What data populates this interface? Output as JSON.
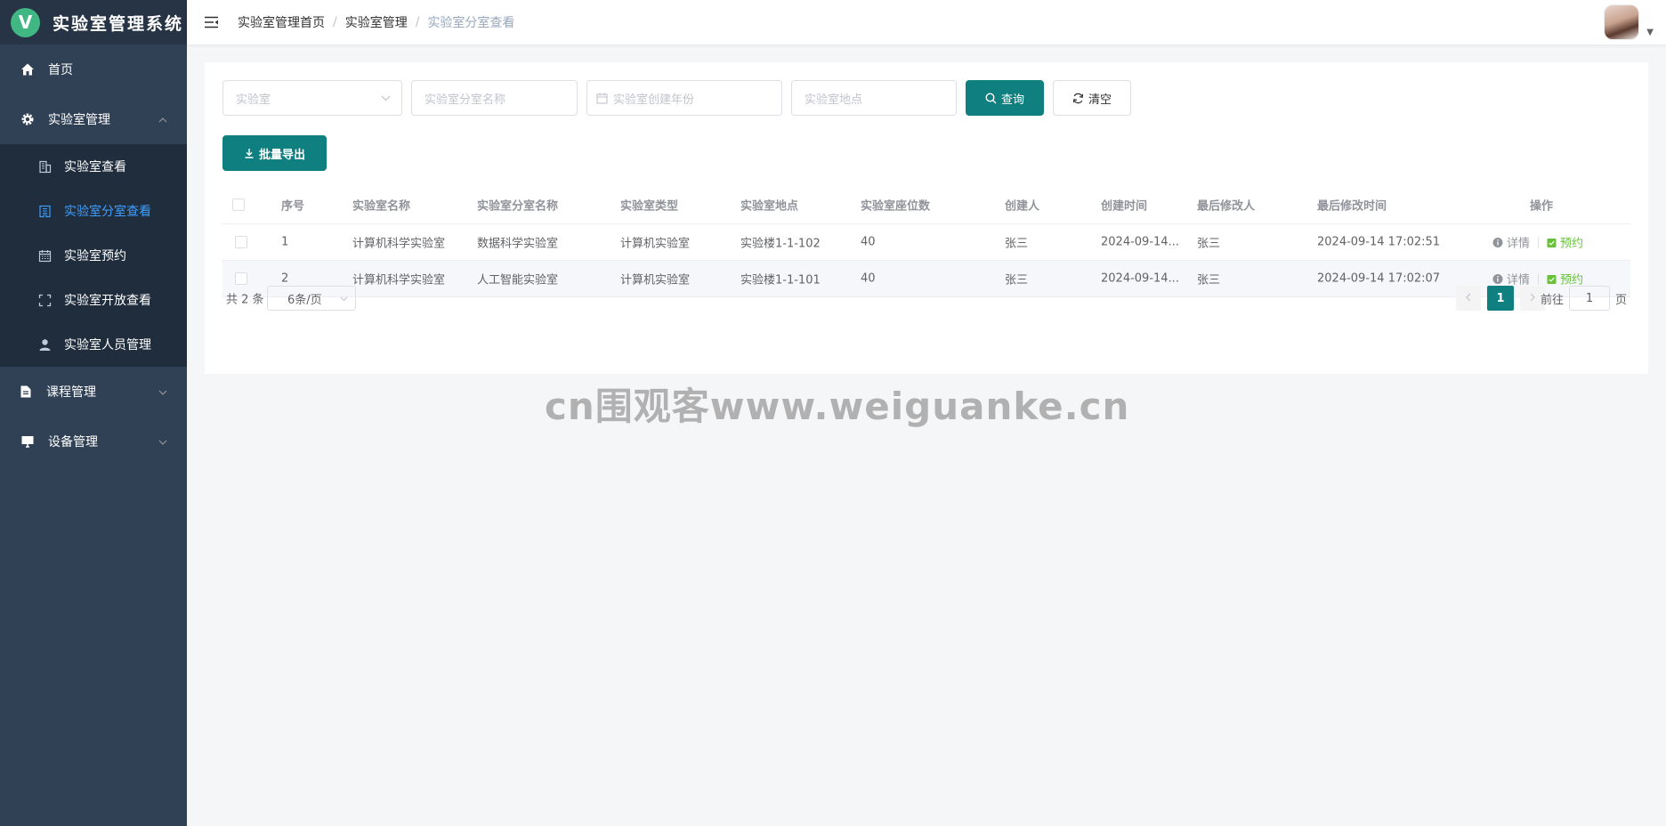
{
  "app": {
    "logo_letter": "V",
    "title": "实验室管理系统"
  },
  "sidebar": {
    "items": [
      {
        "label": "首页"
      },
      {
        "label": "实验室管理",
        "children": [
          {
            "label": "实验室查看"
          },
          {
            "label": "实验室分室查看"
          },
          {
            "label": "实验室预约"
          },
          {
            "label": "实验室开放查看"
          },
          {
            "label": "实验室人员管理"
          }
        ]
      },
      {
        "label": "课程管理"
      },
      {
        "label": "设备管理"
      }
    ]
  },
  "header": {
    "breadcrumb": [
      "实验室管理首页",
      "实验室管理",
      "实验室分室查看"
    ]
  },
  "filters": {
    "lab_placeholder": "实验室",
    "room_name_placeholder": "实验室分室名称",
    "year_placeholder": "实验室创建年份",
    "location_placeholder": "实验室地点",
    "search_label": "查询",
    "clear_label": "清空"
  },
  "toolbar": {
    "export_label": "批量导出"
  },
  "table": {
    "columns": [
      "序号",
      "实验室名称",
      "实验室分室名称",
      "实验室类型",
      "实验室地点",
      "实验室座位数",
      "创建人",
      "创建时间",
      "最后修改人",
      "最后修改时间",
      "操作"
    ],
    "rows": [
      {
        "index": "1",
        "lab": "计算机科学实验室",
        "room": "数据科学实验室",
        "type": "计算机实验室",
        "location": "实验楼1-1-102",
        "seats": "40",
        "creator": "张三",
        "created": "2024-09-14...",
        "modifier": "张三",
        "modified": "2024-09-14 17:02:51"
      },
      {
        "index": "2",
        "lab": "计算机科学实验室",
        "room": "人工智能实验室",
        "type": "计算机实验室",
        "location": "实验楼1-1-101",
        "seats": "40",
        "creator": "张三",
        "created": "2024-09-14...",
        "modifier": "张三",
        "modified": "2024-09-14 17:02:07"
      }
    ],
    "actions": {
      "detail": "详情",
      "reserve": "预约"
    }
  },
  "pagination": {
    "total": "共 2 条",
    "page_size": "6条/页",
    "current": "1",
    "goto_prefix": "前往",
    "goto_value": "1",
    "goto_suffix": "页"
  },
  "watermark": "cn围观客www.weiguanke.cn",
  "colors": {
    "sidebar": "#304156",
    "primary": "#0f7f7f",
    "active": "#409eff",
    "reserve": "#67c23a"
  }
}
